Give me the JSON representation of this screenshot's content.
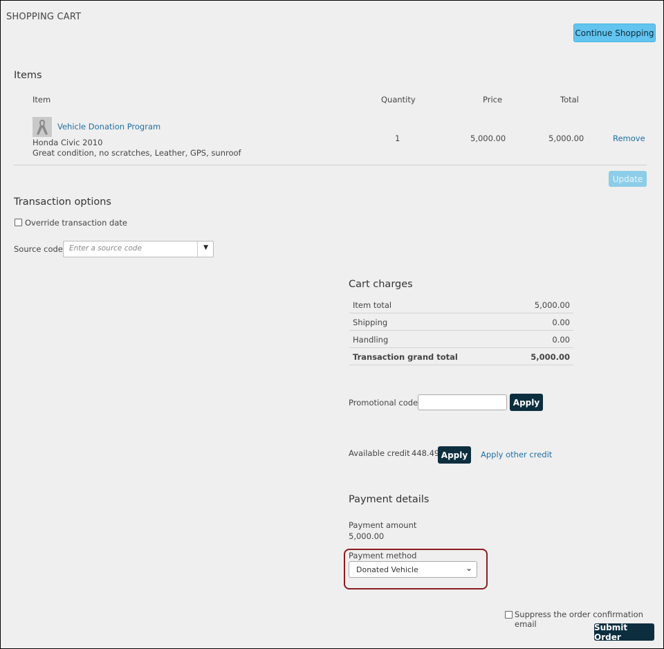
{
  "page": {
    "title": "SHOPPING CART",
    "continue_label": "Continue Shopping"
  },
  "items": {
    "heading": "Items",
    "columns": {
      "item": "Item",
      "quantity": "Quantity",
      "price": "Price",
      "total": "Total"
    },
    "rows": [
      {
        "name": "Vehicle Donation Program",
        "line1": "Honda Civic 2010",
        "line2": "Great condition, no scratches, Leather, GPS, sunroof",
        "quantity": "1",
        "price": "5,000.00",
        "total": "5,000.00",
        "remove_label": "Remove"
      }
    ],
    "update_label": "Update"
  },
  "transaction": {
    "heading": "Transaction options",
    "override_label": "Override transaction date",
    "source_label": "Source code",
    "source_placeholder": "Enter a source code"
  },
  "charges": {
    "heading": "Cart charges",
    "rows": [
      {
        "label": "Item total",
        "value": "5,000.00"
      },
      {
        "label": "Shipping",
        "value": "0.00"
      },
      {
        "label": "Handling",
        "value": "0.00"
      },
      {
        "label": "Transaction grand total",
        "value": "5,000.00"
      }
    ]
  },
  "promo": {
    "label": "Promotional code",
    "value": "",
    "apply_label": "Apply"
  },
  "credit": {
    "label": "Available credit",
    "amount": "448.49",
    "apply_label": "Apply",
    "other_label": "Apply other credit"
  },
  "payment": {
    "heading": "Payment details",
    "amount_label": "Payment amount",
    "amount_value": "5,000.00",
    "method_label": "Payment method",
    "method_value": "Donated Vehicle"
  },
  "footer": {
    "suppress_label": "Suppress the order confirmation email",
    "submit_label": "Submit Order"
  },
  "colors": {
    "accent": "#62c4ef",
    "dark_button": "#0c2e3f",
    "link": "#1d6fa5",
    "highlight": "#8b1c20"
  },
  "icons": {
    "item_thumbnail": "ribbon-icon",
    "dropdown": "caret-down-icon"
  }
}
